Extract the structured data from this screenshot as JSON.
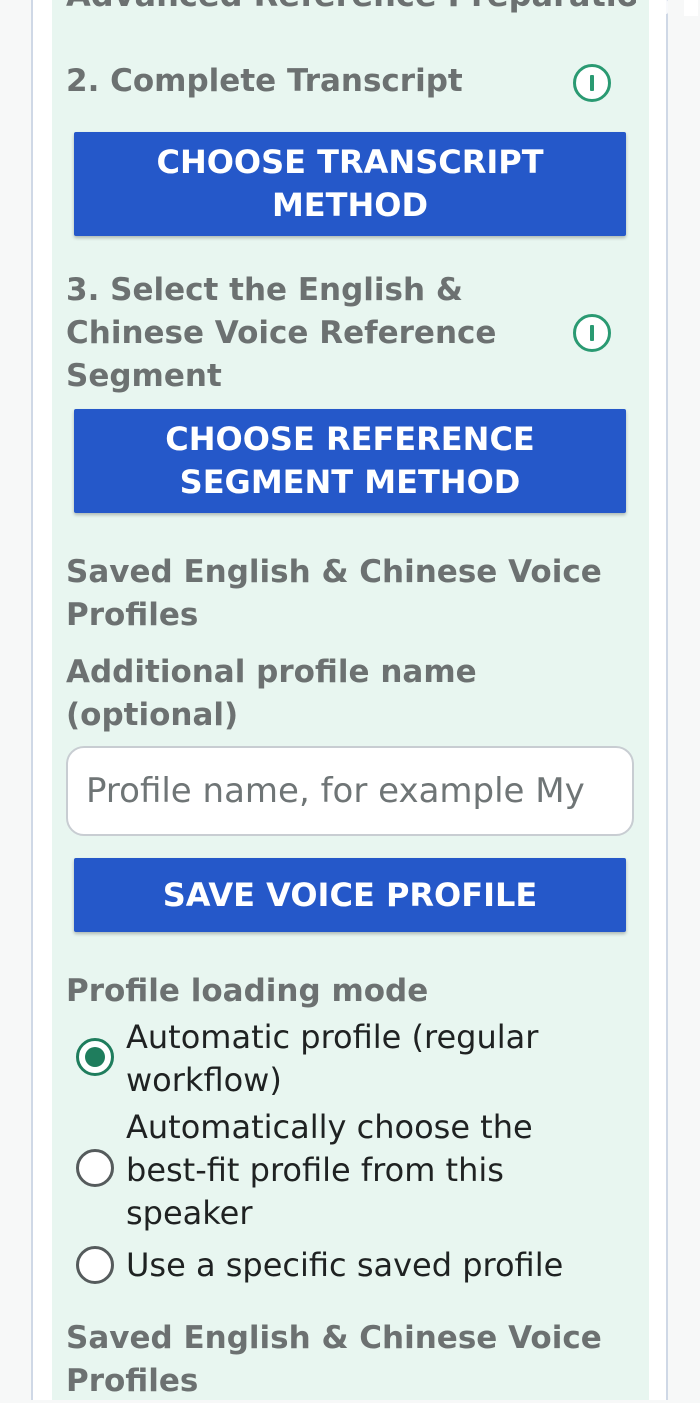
{
  "header": {
    "clipped_title": "Advanced Reference Preparation"
  },
  "transcript_section": {
    "heading": "2. Complete Transcript",
    "button_label": "CHOOSE TRANSCRIPT METHOD"
  },
  "reference_section": {
    "heading": "3. Select the English & Chinese Voice Reference Segment",
    "button_label": "CHOOSE REFERENCE SEGMENT METHOD"
  },
  "profiles_section": {
    "saved_label": "Saved English & Chinese Voice Profiles",
    "name_label": "Additional profile name (optional)",
    "name_input": {
      "value": "",
      "placeholder": "Profile name, for example My"
    },
    "save_button_label": "SAVE VOICE PROFILE"
  },
  "loading_mode": {
    "heading": "Profile loading mode",
    "options": [
      {
        "label": "Automatic profile (regular workflow)",
        "selected": true
      },
      {
        "label": "Automatically choose the best-fit profile from this speaker",
        "selected": false
      },
      {
        "label": "Use a specific saved profile",
        "selected": false
      }
    ]
  },
  "footer_section": {
    "saved_label": "Saved English & Chinese Voice Profiles"
  },
  "colors": {
    "panel_bg": "#e8f6f0",
    "primary_button": "#2558c9",
    "accent_green": "#2a9a72",
    "heading_gray": "#6c7171"
  }
}
